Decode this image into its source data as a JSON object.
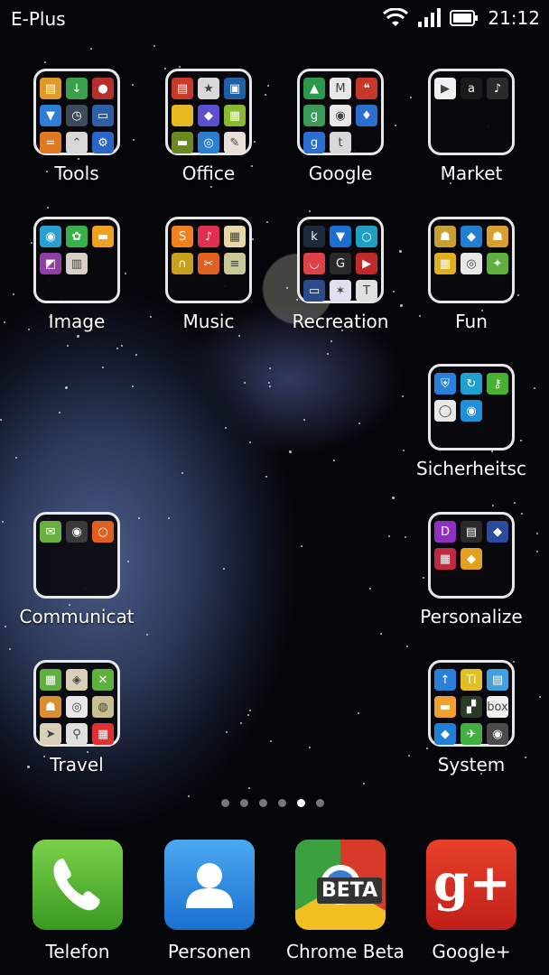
{
  "status": {
    "carrier": "E-Plus",
    "time": "21:12"
  },
  "folders": [
    {
      "label": "Tools",
      "icons": [
        {
          "name": "calc-icon",
          "color": "#e09a2a",
          "glyph": "▤"
        },
        {
          "name": "download-icon",
          "color": "#3aa04a",
          "glyph": "↓"
        },
        {
          "name": "recorder-icon",
          "color": "#b5302a",
          "glyph": "●"
        },
        {
          "name": "flashlight-icon",
          "color": "#2f7fd8",
          "glyph": "▼"
        },
        {
          "name": "clock-icon",
          "color": "#3c4a5c",
          "glyph": "◷"
        },
        {
          "name": "tape-icon",
          "color": "#2d5fa8",
          "glyph": "▭"
        },
        {
          "name": "notes-icon",
          "color": "#e07a20",
          "glyph": "="
        },
        {
          "name": "compass-icon",
          "color": "#d8d8d8",
          "glyph": "⌃"
        },
        {
          "name": "settings-gear-icon",
          "color": "#2a66c8",
          "glyph": "⚙"
        }
      ]
    },
    {
      "label": "Office",
      "icons": [
        {
          "name": "doc-icon",
          "color": "#c83a2a",
          "glyph": "▤"
        },
        {
          "name": "star-icon",
          "color": "#d8d8d8",
          "glyph": "★"
        },
        {
          "name": "lock-icon",
          "color": "#1e5fa8",
          "glyph": "▣"
        },
        {
          "name": "note-icon",
          "color": "#e8b820",
          "glyph": ""
        },
        {
          "name": "grid-icon",
          "color": "#5a4fd0",
          "glyph": "◆"
        },
        {
          "name": "sheet-icon",
          "color": "#8ab830",
          "glyph": "▦"
        },
        {
          "name": "scan-icon",
          "color": "#6a8a20",
          "glyph": "▬"
        },
        {
          "name": "search-app-icon",
          "color": "#2a7fd0",
          "glyph": "◎"
        },
        {
          "name": "chart-icon",
          "color": "#e8e0d8",
          "glyph": "✎"
        }
      ]
    },
    {
      "label": "Google",
      "icons": [
        {
          "name": "drive-icon",
          "color": "#2a9a4a",
          "glyph": "▲"
        },
        {
          "name": "gmail-icon",
          "color": "#e8e8e8",
          "glyph": "M"
        },
        {
          "name": "hangouts-icon",
          "color": "#c8382a",
          "glyph": "❝"
        },
        {
          "name": "googleplus-small-icon",
          "color": "#3a9a58",
          "glyph": "g"
        },
        {
          "name": "chrome-small-icon",
          "color": "#e8e8e8",
          "glyph": "◉"
        },
        {
          "name": "voice-search-icon",
          "color": "#2a6fd0",
          "glyph": "♦"
        },
        {
          "name": "google-search-icon",
          "color": "#2a6fd0",
          "glyph": "g"
        },
        {
          "name": "talk-icon",
          "color": "#d8d8d8",
          "glyph": "t"
        }
      ]
    },
    {
      "label": "Market",
      "icons": [
        {
          "name": "play-store-icon",
          "color": "#f0f0f0",
          "glyph": "▶"
        },
        {
          "name": "amazon-icon",
          "color": "#1a1a1a",
          "glyph": "a"
        },
        {
          "name": "amazon-mp3-icon",
          "color": "#2a2a2a",
          "glyph": "♪"
        }
      ]
    },
    {
      "label": "Image",
      "icons": [
        {
          "name": "camera-icon",
          "color": "#2aa0d0",
          "glyph": "◉"
        },
        {
          "name": "gallery-icon",
          "color": "#3ab04a",
          "glyph": "✿"
        },
        {
          "name": "sunset-icon",
          "color": "#f0a020",
          "glyph": "▬"
        },
        {
          "name": "photo-editor-icon",
          "color": "#9040a0",
          "glyph": "◩"
        },
        {
          "name": "filmstrip-icon",
          "color": "#d8d0c8",
          "glyph": "▥"
        }
      ]
    },
    {
      "label": "Music",
      "icons": [
        {
          "name": "soundhound-icon",
          "color": "#f08020",
          "glyph": "S"
        },
        {
          "name": "music-note-icon",
          "color": "#e03050",
          "glyph": "♪"
        },
        {
          "name": "radio-icon",
          "color": "#e8d8a8",
          "glyph": "▦"
        },
        {
          "name": "headphones-icon",
          "color": "#c8a020",
          "glyph": "∩"
        },
        {
          "name": "scissors-icon",
          "color": "#e06020",
          "glyph": "✂"
        },
        {
          "name": "equalizer-icon",
          "color": "#c8c898",
          "glyph": "≡"
        }
      ]
    },
    {
      "label": "Recreation",
      "icons": [
        {
          "name": "kindle-icon",
          "color": "#1a2a3a",
          "glyph": "k"
        },
        {
          "name": "reader-icon",
          "color": "#1a70d0",
          "glyph": "▼"
        },
        {
          "name": "ring-icon",
          "color": "#20a0c0",
          "glyph": "○"
        },
        {
          "name": "pocket-icon",
          "color": "#e0404a",
          "glyph": "◡"
        },
        {
          "name": "tivo-geek-icon",
          "color": "#2a2a2a",
          "glyph": "G"
        },
        {
          "name": "video-icon",
          "color": "#c02a2a",
          "glyph": "▶"
        },
        {
          "name": "tv-app-icon",
          "color": "#2a4a8a",
          "glyph": "▭"
        },
        {
          "name": "news-icon",
          "color": "#e0e0f0",
          "glyph": "✶"
        },
        {
          "name": "tvguide-icon",
          "color": "#e0e0e0",
          "glyph": "T"
        }
      ]
    },
    {
      "label": "Fun",
      "icons": [
        {
          "name": "temple-run-icon",
          "color": "#c8a030",
          "glyph": "☗"
        },
        {
          "name": "game-blue-icon",
          "color": "#2080d0",
          "glyph": "◆"
        },
        {
          "name": "temple-run-2-icon",
          "color": "#d8a030",
          "glyph": "☗"
        },
        {
          "name": "game-yellow-icon",
          "color": "#e0b020",
          "glyph": "▦"
        },
        {
          "name": "spiral-icon",
          "color": "#e8e8e8",
          "glyph": "◎"
        },
        {
          "name": "puzzle-icon",
          "color": "#60b040",
          "glyph": "✦"
        }
      ]
    },
    {
      "label": "Sicherheitsc",
      "icons": [
        {
          "name": "shield-icon",
          "color": "#2a80d8",
          "glyph": "⛨"
        },
        {
          "name": "refresh-icon",
          "color": "#20a0d0",
          "glyph": "↻"
        },
        {
          "name": "key-icon",
          "color": "#4ab030",
          "glyph": "⚷"
        },
        {
          "name": "record-icon",
          "color": "#e8e8e8",
          "glyph": "◯"
        },
        {
          "name": "power-icon",
          "color": "#2090d8",
          "glyph": "◉"
        }
      ]
    },
    {
      "label": "Communicat",
      "icons": [
        {
          "name": "sms-icon",
          "color": "#6ab040",
          "glyph": "✉"
        },
        {
          "name": "owl-icon",
          "color": "#3a3a3a",
          "glyph": "◉"
        },
        {
          "name": "chat-icon",
          "color": "#e06020",
          "glyph": "○"
        }
      ]
    },
    {
      "label": "Personalize",
      "icons": [
        {
          "name": "launcher-icon",
          "color": "#9030c0",
          "glyph": "D"
        },
        {
          "name": "widget-clock-icon",
          "color": "#2a2a2a",
          "glyph": "▤"
        },
        {
          "name": "theme-icon",
          "color": "#2a4aa0",
          "glyph": "◆"
        },
        {
          "name": "keyboard-icon",
          "color": "#c02a40",
          "glyph": "▦"
        },
        {
          "name": "wallpaper-icon",
          "color": "#e0a020",
          "glyph": "◆"
        }
      ]
    },
    {
      "label": "Travel",
      "icons": [
        {
          "name": "maps-icon",
          "color": "#60b040",
          "glyph": "▦"
        },
        {
          "name": "maps-2-icon",
          "color": "#d8d0b8",
          "glyph": "◈"
        },
        {
          "name": "xbox-icon",
          "color": "#60b040",
          "glyph": "✕"
        },
        {
          "name": "tiger-icon",
          "color": "#d89030",
          "glyph": "☗"
        },
        {
          "name": "tripadvisor-icon",
          "color": "#e8e8e8",
          "glyph": "◎"
        },
        {
          "name": "earth-icon",
          "color": "#c8c090",
          "glyph": "◍"
        },
        {
          "name": "navigation-icon",
          "color": "#d8d0b8",
          "glyph": "➤"
        },
        {
          "name": "pin-icon",
          "color": "#e0e0e0",
          "glyph": "⚲"
        },
        {
          "name": "transit-icon",
          "color": "#e03030",
          "glyph": "▦"
        }
      ]
    },
    {
      "label": "System",
      "icons": [
        {
          "name": "upload-icon",
          "color": "#2a80d8",
          "glyph": "↑"
        },
        {
          "name": "titanium-icon",
          "color": "#e0c020",
          "glyph": "Ti"
        },
        {
          "name": "db-icon",
          "color": "#40a0e0",
          "glyph": "▤"
        },
        {
          "name": "folder-icon",
          "color": "#f0a030",
          "glyph": "▬"
        },
        {
          "name": "terminal-icon",
          "color": "#2a3a2a",
          "glyph": "▞"
        },
        {
          "name": "box-icon",
          "color": "#f0f0f0",
          "glyph": "box"
        },
        {
          "name": "dropbox-icon",
          "color": "#2080d8",
          "glyph": "◆"
        },
        {
          "name": "airdroid-icon",
          "color": "#40b040",
          "glyph": "✈"
        },
        {
          "name": "settings-icon",
          "color": "#4a4a4a",
          "glyph": "◉"
        }
      ]
    }
  ],
  "pager": {
    "count": 6,
    "active": 5
  },
  "dock": [
    {
      "label": "Telefon",
      "icon": "phone-icon",
      "color": "#4ab030"
    },
    {
      "label": "Personen",
      "icon": "contacts-icon",
      "color": "#2a8ae0"
    },
    {
      "label": "Chrome Beta",
      "icon": "chrome-beta-icon",
      "color": "#2a2a2a",
      "badge": "BETA"
    },
    {
      "label": "Google+",
      "icon": "googleplus-icon",
      "color": "#d83020",
      "badge": "g+"
    }
  ]
}
